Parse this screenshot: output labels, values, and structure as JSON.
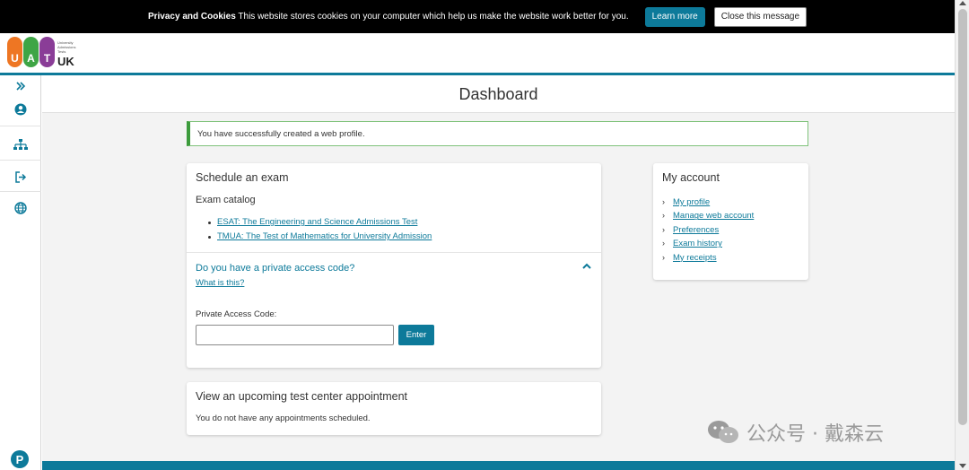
{
  "cookie_bar": {
    "heading": "Privacy and Cookies",
    "message": "This website stores cookies on your computer which help us make the website work better for you.",
    "learn_more": "Learn more",
    "close": "Close this message"
  },
  "logo": {
    "letters": [
      "U",
      "A",
      "T"
    ],
    "small_lines": [
      "University",
      "Admissions",
      "Tests"
    ],
    "suffix": "UK"
  },
  "sidebar": {
    "icons": [
      "expand-icon",
      "user-icon",
      "sitemap-icon",
      "sign-out-icon",
      "globe-icon"
    ],
    "footer_logo": "P"
  },
  "page": {
    "title": "Dashboard"
  },
  "alert": {
    "message": "You have successfully created a web profile."
  },
  "schedule": {
    "title": "Schedule an exam",
    "catalog_label": "Exam catalog",
    "exams": [
      "ESAT: The Engineering and Science Admissions Test",
      "TMUA: The Test of Mathematics for University Admission"
    ],
    "private_question": "Do you have a private access code?",
    "what_link": "What is this?",
    "code_label": "Private Access Code:",
    "code_value": "",
    "enter_label": "Enter"
  },
  "upcoming": {
    "title": "View an upcoming test center appointment",
    "message": "You do not have any appointments scheduled."
  },
  "account": {
    "title": "My account",
    "links": [
      "My profile",
      "Manage web account",
      "Preferences",
      "Exam history",
      "My receipts"
    ]
  },
  "watermark": {
    "text": "公众号 · 戴森云"
  },
  "colors": {
    "brand": "#0d7a9a",
    "success": "#3c9b3c",
    "logo_u": "#ee7623",
    "logo_a": "#3ea545",
    "logo_t": "#8a3d97"
  }
}
